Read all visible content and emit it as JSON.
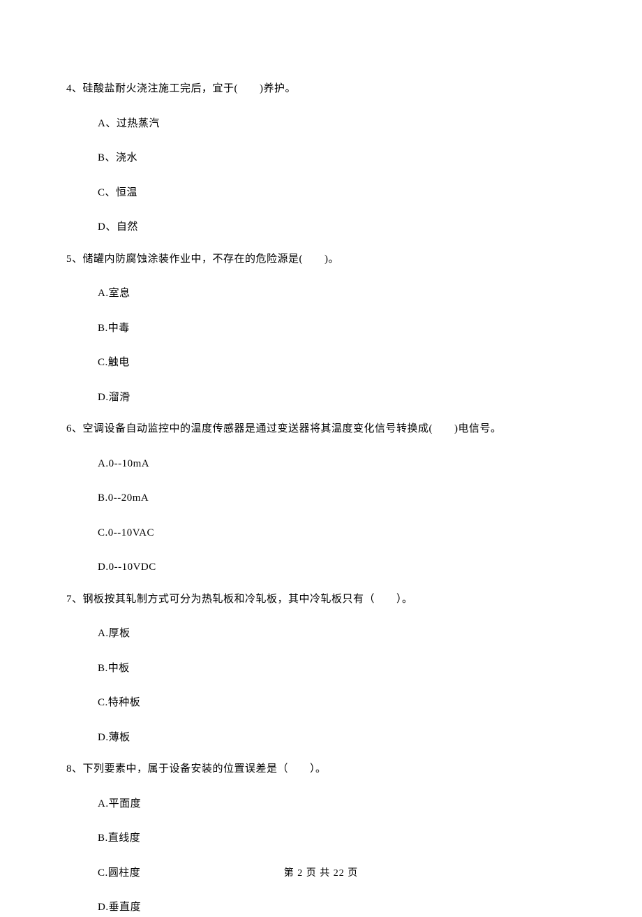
{
  "questions": [
    {
      "number": "4",
      "stem": "4、硅酸盐耐火浇注施工完后，宜于(　　)养护。",
      "options": [
        {
          "label": "A、过热蒸汽"
        },
        {
          "label": "B、浇水"
        },
        {
          "label": "C、恒温"
        },
        {
          "label": "D、自然"
        }
      ]
    },
    {
      "number": "5",
      "stem": "5、储罐内防腐蚀涂装作业中，不存在的危险源是(　　)。",
      "options": [
        {
          "label": "A.室息"
        },
        {
          "label": "B.中毒"
        },
        {
          "label": "C.触电"
        },
        {
          "label": "D.溜滑"
        }
      ]
    },
    {
      "number": "6",
      "stem": "6、空调设备自动监控中的温度传感器是通过变送器将其温度变化信号转换成(　　)电信号。",
      "options": [
        {
          "label": "A.0--10mA"
        },
        {
          "label": "B.0--20mA"
        },
        {
          "label": "C.0--10VAC"
        },
        {
          "label": "D.0--10VDC"
        }
      ]
    },
    {
      "number": "7",
      "stem": "7、钢板按其轧制方式可分为热轧板和冷轧板，其中冷轧板只有（　　）。",
      "options": [
        {
          "label": "A.厚板"
        },
        {
          "label": "B.中板"
        },
        {
          "label": "C.特种板"
        },
        {
          "label": "D.薄板"
        }
      ]
    },
    {
      "number": "8",
      "stem": "8、下列要素中，属于设备安装的位置误差是（　　）。",
      "options": [
        {
          "label": "A.平面度"
        },
        {
          "label": "B.直线度"
        },
        {
          "label": "C.圆柱度"
        },
        {
          "label": "D.垂直度"
        }
      ]
    }
  ],
  "footer": "第 2 页 共 22 页"
}
